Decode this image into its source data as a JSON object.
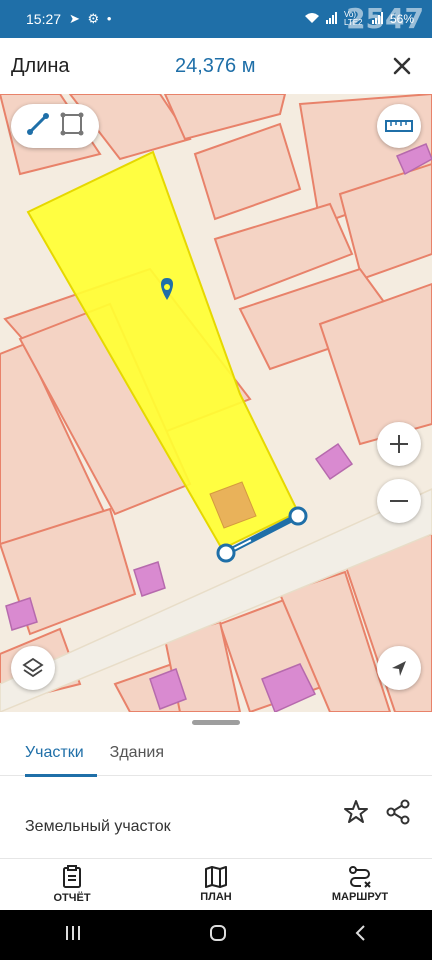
{
  "status_bar": {
    "time": "15:27",
    "battery": "56%",
    "network": "Vo) LTE2",
    "watermark": "2547"
  },
  "header": {
    "title": "Длина",
    "value": "24,376 м"
  },
  "map": {
    "colors": {
      "parcel_fill": "#f4d3c4",
      "parcel_border": "#e8826a",
      "road": "#f2eee6",
      "selected_parcel": "#ffff33",
      "building": "#d98ad0",
      "measure_line": "#1f6fa8"
    }
  },
  "sheet": {
    "tabs": [
      {
        "label": "Участки"
      },
      {
        "label": "Здания"
      }
    ],
    "parcel_type": "Земельный участок"
  },
  "bottom_nav": {
    "items": [
      {
        "label": "ОТЧЁТ",
        "icon": "report-icon"
      },
      {
        "label": "ПЛАН",
        "icon": "map-plan-icon"
      },
      {
        "label": "МАРШРУТ",
        "icon": "route-icon"
      }
    ]
  }
}
